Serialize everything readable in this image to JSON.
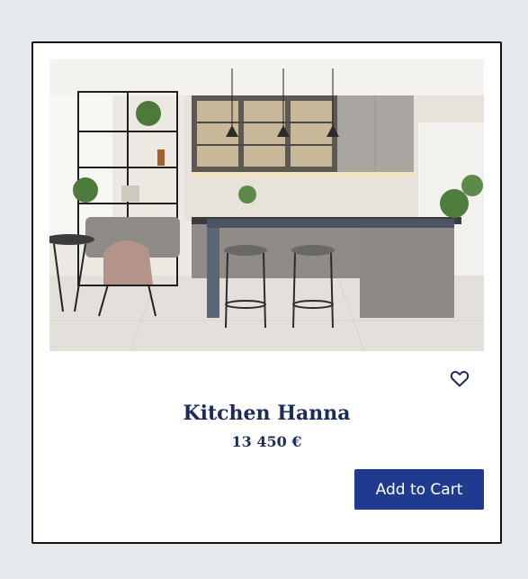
{
  "product": {
    "name": "Kitchen Hanna",
    "price": "13 450 €",
    "add_to_cart_label": "Add to Cart",
    "favorite_icon": "heart-outline-icon"
  },
  "colors": {
    "page_background": "#e5e8ec",
    "title_text": "#1b2b5a",
    "button_background": "#1f3b8f",
    "button_text": "#ffffff",
    "card_border": "#111111"
  }
}
